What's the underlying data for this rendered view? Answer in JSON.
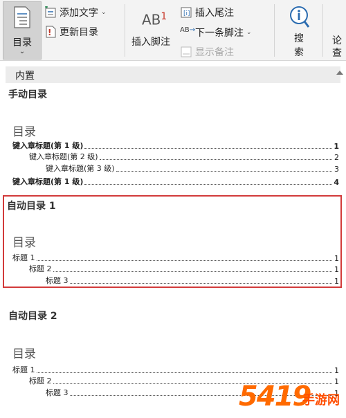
{
  "ribbon": {
    "toc_label": "目录",
    "add_text_label": "添加文字",
    "update_toc_label": "更新目录",
    "insert_footnote_label": "插入脚注",
    "footnote_icon_text": "AB",
    "footnote_icon_sup": "1",
    "insert_endnote_label": "插入尾注",
    "next_footnote_label": "下一条脚注",
    "show_notes_label": "显示备注",
    "search_label_1": "搜",
    "search_label_2": "索",
    "cut_label_1": "论",
    "cut_label_2": "查"
  },
  "gallery": {
    "header": "内置",
    "manual": {
      "title": "手动目录",
      "heading": "目录",
      "entries": [
        {
          "text": "键入章标题(第 1 级)",
          "page": "1"
        },
        {
          "text": "键入章标题(第 2 级)",
          "page": "2"
        },
        {
          "text": "键入章标题(第 3 级)",
          "page": "3"
        },
        {
          "text": "键入章标题(第 1 级)",
          "page": "4"
        }
      ]
    },
    "auto1": {
      "title": "自动目录 1",
      "heading": "目录",
      "entries": [
        {
          "text": "标题 1",
          "page": "1"
        },
        {
          "text": "标题 2",
          "page": "1"
        },
        {
          "text": "标题 3",
          "page": "1"
        }
      ]
    },
    "auto2": {
      "title": "自动目录 2",
      "heading": "目录",
      "entries": [
        {
          "text": "标题 1",
          "page": "1"
        },
        {
          "text": "标题 2",
          "page": "1"
        },
        {
          "text": "标题 3",
          "page": "1"
        }
      ]
    }
  },
  "watermark": {
    "number": "5419",
    "text": "手游网"
  },
  "colors": {
    "highlight": "#d23a3a",
    "watermark": "#ff6a00"
  }
}
